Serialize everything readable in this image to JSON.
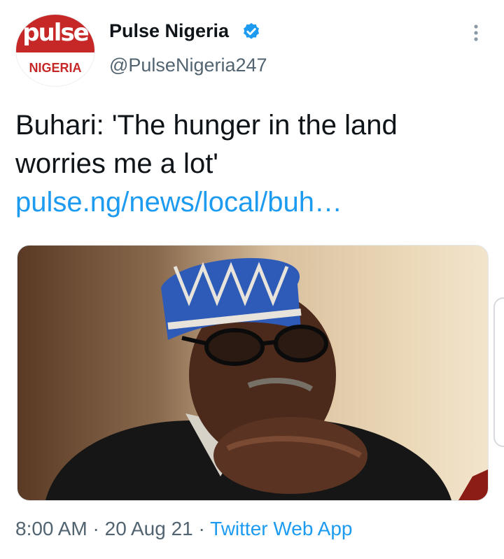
{
  "account": {
    "avatar_logo": "pulse",
    "avatar_sub": "NIGERIA",
    "name": "Pulse Nigeria",
    "handle": "@PulseNigeria247",
    "verified_icon": "verified-badge-icon",
    "more_icon": "more-vertical-icon"
  },
  "tweet": {
    "text": "Buhari: 'The hunger in the land worries me a lot'",
    "link": "pulse.ng/news/local/buh…"
  },
  "meta": {
    "time": "8:00 AM",
    "sep1": " · ",
    "date": "20 Aug 21",
    "sep2": " · ",
    "app": "Twitter Web App"
  },
  "colors": {
    "link": "#1d9bf0",
    "brand_red": "#c62828",
    "verified": "#1d9bf0",
    "secondary_text": "#536471"
  }
}
